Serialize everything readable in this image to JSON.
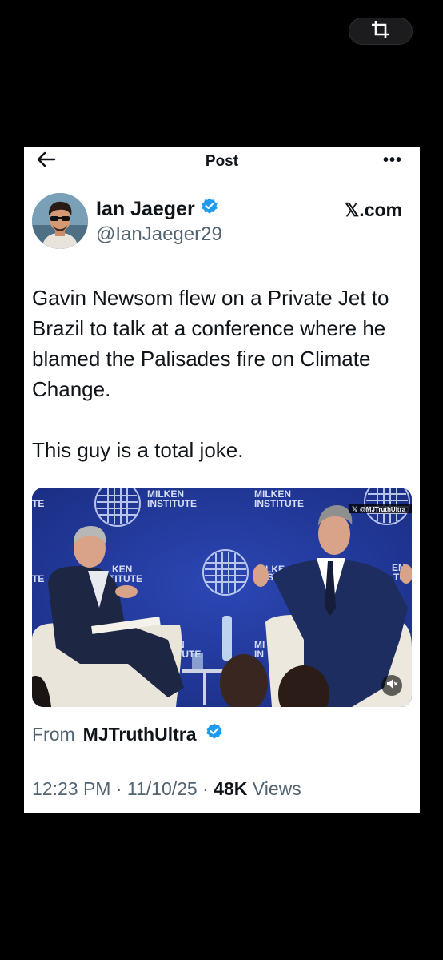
{
  "system": {
    "crop_icon": "crop-icon"
  },
  "header": {
    "title": "Post",
    "back_icon": "arrow-left-icon",
    "more_icon": "more-horizontal-icon",
    "more_label": "•••"
  },
  "author": {
    "name": "Ian Jaeger",
    "handle": "@IanJaeger29",
    "verified": true,
    "site": "𝕏.com"
  },
  "tweet": {
    "paragraphs": [
      "Gavin Newsom flew on a Private Jet to Brazil to talk at a conference where he blamed the Palisades fire on Climate Change.",
      "This guy is a total joke."
    ]
  },
  "media": {
    "type": "video",
    "backdrop_logo": "MILKEN INSTITUTE",
    "backdrop_line1": "MILKEN",
    "backdrop_line2": "INSTITUTE",
    "frag_left_1": "TE",
    "frag_left_2": "TE",
    "frag_ken": "KEN",
    "frag_titute": "TITUTE",
    "frag_n": "N",
    "frag_tute": "TUTE",
    "frag_mi": "MI",
    "frag_in": "IN",
    "frag_lke": "LKE",
    "frag_st": "ST",
    "frag_en": "EN",
    "frag_tu": "TU",
    "watermark": "@MJTruthUltra",
    "mute_icon": "speaker-muted-icon"
  },
  "source": {
    "prefix": "From",
    "name": "MJTruthUltra",
    "verified": true
  },
  "meta": {
    "time": "12:23 PM",
    "sep": "·",
    "date": "11/10/25",
    "views_count": "48K",
    "views_label": "Views"
  },
  "colors": {
    "verified_blue": "#1d9bf0",
    "backdrop_blue": "#233a9c",
    "text_secondary": "#536471"
  }
}
